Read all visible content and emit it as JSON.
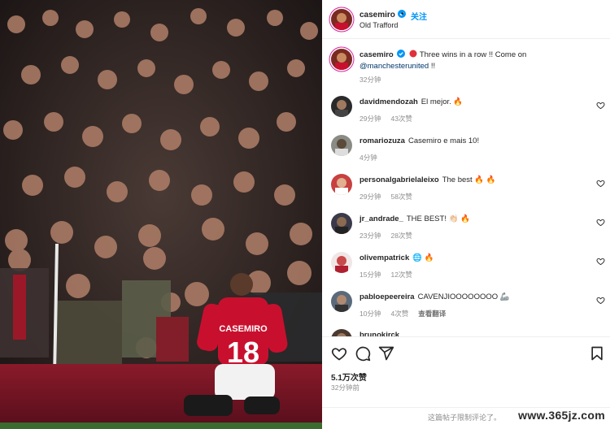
{
  "post": {
    "author": "casemiro",
    "verified": true,
    "follow_label": "关注",
    "separator": "•",
    "location": "Old Trafford",
    "jersey_name": "CASEMIRO",
    "jersey_number": "18"
  },
  "caption": {
    "username": "casemiro",
    "text": "Three wins in a row !! Come on",
    "mention": "@manchesterunited",
    "suffix": "!!",
    "time": "32分钟"
  },
  "comments": [
    {
      "username": "davidmendozah",
      "text": "El mejor.",
      "emoji": "🔥",
      "time": "29分钟",
      "likes": "43次赞",
      "translate": ""
    },
    {
      "username": "romariozuza",
      "text": "Casemiro e mais 10!",
      "emoji": "",
      "time": "4分钟",
      "likes": "",
      "translate": ""
    },
    {
      "username": "personalgabrielaleixo",
      "text": "The best",
      "emoji": "🔥 🔥",
      "time": "29分钟",
      "likes": "58次赞",
      "translate": ""
    },
    {
      "username": "jr_andrade_",
      "text": "THE BEST!",
      "emoji": "👏🏻 🔥",
      "time": "23分钟",
      "likes": "28次赞",
      "translate": ""
    },
    {
      "username": "olivempatrick",
      "text": "",
      "emoji": "🌐 🔥",
      "time": "15分钟",
      "likes": "12次赞",
      "translate": ""
    },
    {
      "username": "pabloepeereira",
      "text": "CAVENJIOOOOOOOO",
      "emoji": "🦾",
      "time": "10分钟",
      "likes": "4次赞",
      "translate": "查看翻译"
    },
    {
      "username": "brunokirck",
      "text": "",
      "emoji": "",
      "time": "",
      "likes": "",
      "translate": ""
    }
  ],
  "actions": {
    "like_icon": "heart-icon",
    "comment_icon": "comment-icon",
    "share_icon": "share-icon",
    "save_icon": "bookmark-icon",
    "likes_count": "5.1万次赞",
    "post_time": "32分钟前",
    "restricted_notice": "这篇帖子限制评论了。",
    "watermark": "www.365jz.com"
  },
  "colors": {
    "accent_blue": "#0095f6",
    "mention": "#00376b",
    "muted": "#8e8e8e",
    "united_red": "#c8102e"
  }
}
